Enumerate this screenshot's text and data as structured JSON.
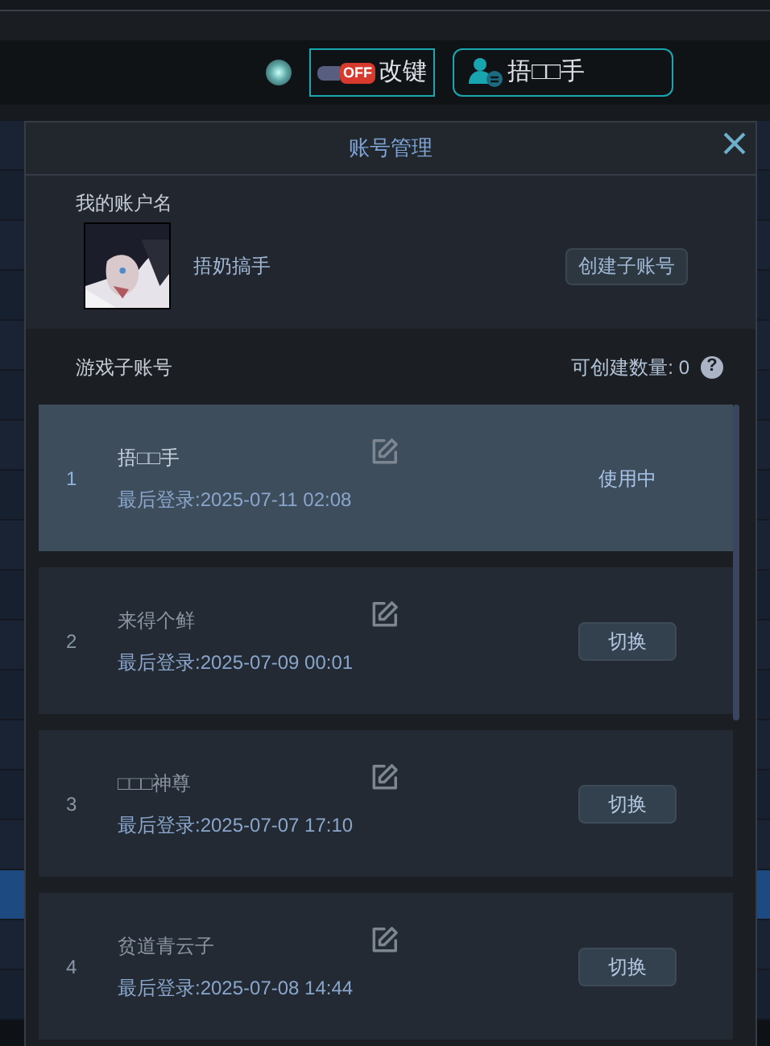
{
  "toolbar": {
    "status_on": true,
    "keymap_button": {
      "toggle_label": "OFF",
      "on": false,
      "label": "改键"
    },
    "user_button": {
      "label": "捂□□手"
    }
  },
  "background_rows": [
    {
      "selected": false
    },
    {
      "selected": false
    },
    {
      "selected": false
    },
    {
      "selected": false
    },
    {
      "selected": false
    },
    {
      "selected": false
    },
    {
      "selected": false
    },
    {
      "selected": false
    },
    {
      "selected": false
    },
    {
      "selected": false
    },
    {
      "selected": false
    },
    {
      "selected": false
    },
    {
      "selected": false
    },
    {
      "selected": false
    },
    {
      "selected": false
    },
    {
      "selected": true
    },
    {
      "selected": false
    },
    {
      "selected": false
    }
  ],
  "dialog": {
    "title": "账号管理",
    "my_account": {
      "heading": "我的账户名",
      "name": "捂奶搞手",
      "create_button": "创建子账号"
    },
    "sub_accounts": {
      "heading": "游戏子账号",
      "quota": "可创建数量: 0",
      "help": "?",
      "items": [
        {
          "index": "1",
          "name": "捂□□手",
          "last_login": "最后登录:2025-07-11 02:08",
          "selected": true,
          "status": "使用中"
        },
        {
          "index": "2",
          "name": "来得个鲜",
          "last_login": "最后登录:2025-07-09 00:01",
          "selected": false,
          "action": "切换"
        },
        {
          "index": "3",
          "name": "□□□神尊",
          "last_login": "最后登录:2025-07-07 17:10",
          "selected": false,
          "action": "切换"
        },
        {
          "index": "4",
          "name": "贫道青云子",
          "last_login": "最后登录:2025-07-08 14:44",
          "selected": false,
          "action": "切换"
        }
      ]
    }
  }
}
